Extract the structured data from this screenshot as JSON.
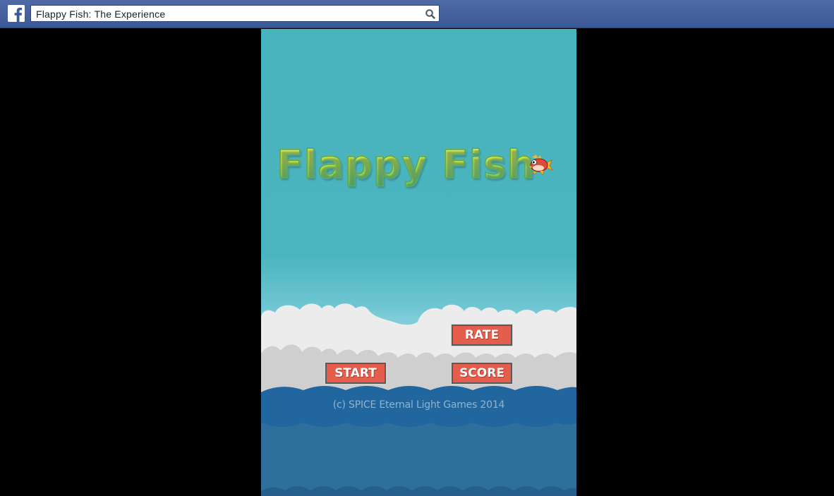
{
  "topbar": {
    "logo_icon": "facebook-f-icon",
    "search_value": "Flappy Fish: The Experience",
    "search_icon": "search-icon",
    "background_color": "#3b5998"
  },
  "game": {
    "title": "Flappy Fish",
    "character_icon": "fish-icon",
    "buttons": {
      "rate": "RATE",
      "start": "START",
      "score": "SCORE"
    },
    "button_color": "#e55d4d",
    "copyright": "(c) SPICE Eternal Light Games 2014",
    "sky_color": "#4ab5bf",
    "water_color": "#2e6f9c"
  }
}
